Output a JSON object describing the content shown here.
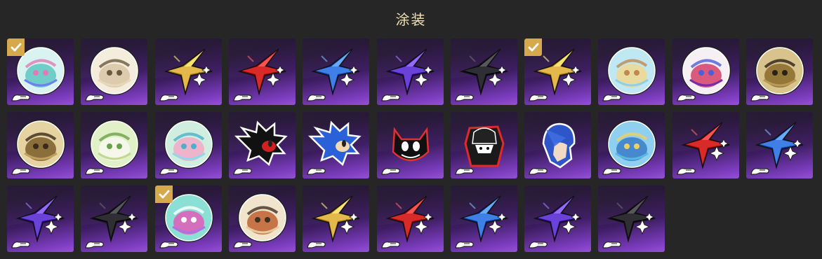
{
  "header": {
    "title": "涂装"
  },
  "items": [
    {
      "kind": "badge",
      "style": "aurora",
      "selected": true
    },
    {
      "kind": "badge",
      "style": "white-cat",
      "selected": false
    },
    {
      "kind": "star",
      "color": "#e4b84a",
      "selected": false
    },
    {
      "kind": "star",
      "color": "#d92a2a",
      "selected": false
    },
    {
      "kind": "star",
      "color": "#3f7fe6",
      "selected": false
    },
    {
      "kind": "star",
      "color": "#6a42d8",
      "selected": false
    },
    {
      "kind": "star",
      "color": "#2e2e34",
      "selected": false
    },
    {
      "kind": "star",
      "color": "#e4b84a",
      "selected": true
    },
    {
      "kind": "badge",
      "style": "blonde-chibi",
      "selected": false
    },
    {
      "kind": "badge",
      "style": "comet-swirl",
      "selected": false
    },
    {
      "kind": "badge",
      "style": "bronze-emblem",
      "selected": false
    },
    {
      "kind": "badge",
      "style": "bronze-wing",
      "selected": false
    },
    {
      "kind": "badge",
      "style": "green-white-cat",
      "selected": false
    },
    {
      "kind": "badge",
      "style": "glass-eye",
      "selected": false
    },
    {
      "kind": "silhouette",
      "style": "shadow-hedgehog",
      "selected": false
    },
    {
      "kind": "silhouette",
      "style": "blue-hedgehog",
      "selected": false
    },
    {
      "kind": "silhouette",
      "style": "grin-cat",
      "selected": false
    },
    {
      "kind": "silhouette",
      "style": "masked-thief",
      "selected": false
    },
    {
      "kind": "silhouette",
      "style": "blue-hair",
      "selected": false
    },
    {
      "kind": "badge",
      "style": "sky-castle",
      "selected": false
    },
    {
      "kind": "star",
      "color": "#d92a2a",
      "selected": false
    },
    {
      "kind": "star",
      "color": "#3f7fe6",
      "selected": false
    },
    {
      "kind": "star",
      "color": "#6a42d8",
      "selected": false
    },
    {
      "kind": "star",
      "color": "#2e2e34",
      "selected": false
    },
    {
      "kind": "badge",
      "style": "pink-cat",
      "selected": true
    },
    {
      "kind": "badge",
      "style": "white-fox",
      "selected": false
    },
    {
      "kind": "star",
      "color": "#e4b84a",
      "selected": false
    },
    {
      "kind": "star",
      "color": "#d92a2a",
      "selected": false
    },
    {
      "kind": "star",
      "color": "#3f7fe6",
      "selected": false
    },
    {
      "kind": "star",
      "color": "#6a42d8",
      "selected": false
    },
    {
      "kind": "star",
      "color": "#2e2e34",
      "selected": false
    }
  ]
}
